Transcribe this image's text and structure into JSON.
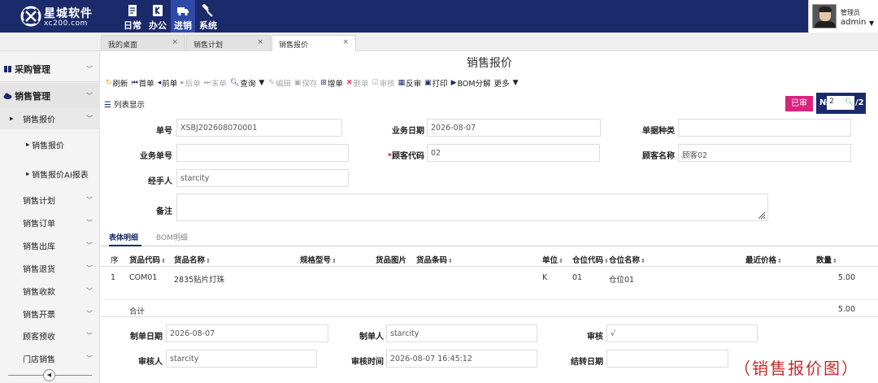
{
  "brand": {
    "name": "星城软件",
    "domain": "xc200.com"
  },
  "topnav": [
    {
      "label": "日常",
      "icon": "document-icon"
    },
    {
      "label": "办公",
      "icon": "k-icon"
    },
    {
      "label": "进销",
      "icon": "truck-icon",
      "active": true
    },
    {
      "label": "系统",
      "icon": "wrench-icon"
    }
  ],
  "user": {
    "role": "管理员",
    "name": "admin"
  },
  "tabs": [
    {
      "label": "我的桌面",
      "close": "×"
    },
    {
      "label": "销售计划",
      "close": "×"
    },
    {
      "label": "销售报价",
      "close": "×",
      "active": true
    }
  ],
  "sidebar": {
    "groups": [
      {
        "label": "采购管理"
      },
      {
        "label": "销售管理"
      }
    ],
    "submenu_open": "销售报价",
    "leaves": [
      "销售报价",
      "销售报价AI报表"
    ],
    "items": [
      "销售计划",
      "销售订单",
      "销售出库",
      "销售退货",
      "销售收款",
      "销售开票",
      "顾客预收",
      "门店销售"
    ]
  },
  "page": {
    "title": "销售报价"
  },
  "toolbar": [
    {
      "label": "刷新",
      "icon": "refresh-icon"
    },
    {
      "label": "首单",
      "icon": "first-icon"
    },
    {
      "label": "前单",
      "icon": "prev-icon"
    },
    {
      "label": "后单",
      "icon": "next-icon",
      "disabled": true
    },
    {
      "label": "末单",
      "icon": "last-icon",
      "disabled": true
    },
    {
      "label": "查询",
      "icon": "search-icon",
      "dropdown": true
    },
    {
      "label": "编辑",
      "icon": "edit-icon",
      "disabled": true
    },
    {
      "label": "保存",
      "icon": "save-icon",
      "disabled": true
    },
    {
      "label": "增单",
      "icon": "add-icon"
    },
    {
      "label": "删单",
      "icon": "delete-icon",
      "disabled": true
    },
    {
      "label": "审核",
      "icon": "check-icon",
      "disabled": true
    },
    {
      "label": "反审",
      "icon": "unapprove-icon"
    },
    {
      "label": "打印",
      "icon": "print-icon"
    },
    {
      "label": "BOM分解",
      "icon": "bom-icon"
    },
    {
      "label": "更多",
      "icon": "",
      "dropdown": true
    }
  ],
  "list_view_label": "列表显示",
  "status_badge": "已审",
  "pager": {
    "symbol": "№",
    "current": "2",
    "total": "/2"
  },
  "form": {
    "doc_no": {
      "label": "单号",
      "value": "XSBJ202608070001"
    },
    "biz_date": {
      "label": "业务日期",
      "value": "2026-08-07"
    },
    "doc_type": {
      "label": "单据种类",
      "value": ""
    },
    "biz_no": {
      "label": "业务单号",
      "value": ""
    },
    "customer_code": {
      "label": "顾客代码",
      "required": "*",
      "value": "02"
    },
    "customer_name": {
      "label": "顾客名称",
      "value": "顾客02"
    },
    "handler": {
      "label": "经手人",
      "value": "starcity"
    },
    "remark": {
      "label": "备注",
      "value": ""
    }
  },
  "subtabs": [
    "表体明细",
    "BOM明细"
  ],
  "grid": {
    "headers": [
      "序",
      "货品代码",
      "货品名称",
      "规格型号",
      "货品图片",
      "货品条码",
      "单位",
      "仓位代码",
      "仓位名称",
      "最近价格",
      "数量"
    ],
    "sort_mark": "⇕",
    "rows": [
      {
        "seq": "1",
        "code": "COM01",
        "name": "2835贴片灯珠",
        "unit": "K",
        "loc_code": "01",
        "loc_name": "仓位01",
        "qty": "5.00"
      }
    ],
    "total_label": "合计",
    "total_qty": "5.00"
  },
  "footer": {
    "created_date": {
      "label": "制单日期",
      "value": "2026-08-07"
    },
    "creator": {
      "label": "制单人",
      "value": "starcity"
    },
    "audit": {
      "label": "审核",
      "value": "√"
    },
    "auditor": {
      "label": "审核人",
      "value": "starcity"
    },
    "audit_time": {
      "label": "审核时间",
      "value": "2026-08-07 16:45:12"
    },
    "settle_date": {
      "label": "结转日期",
      "value": ""
    }
  },
  "caption": "（销售报价图）",
  "colors": {
    "topbar": "#1b2a6b",
    "badge": "#d9237f",
    "caption": "#c52b2b"
  }
}
